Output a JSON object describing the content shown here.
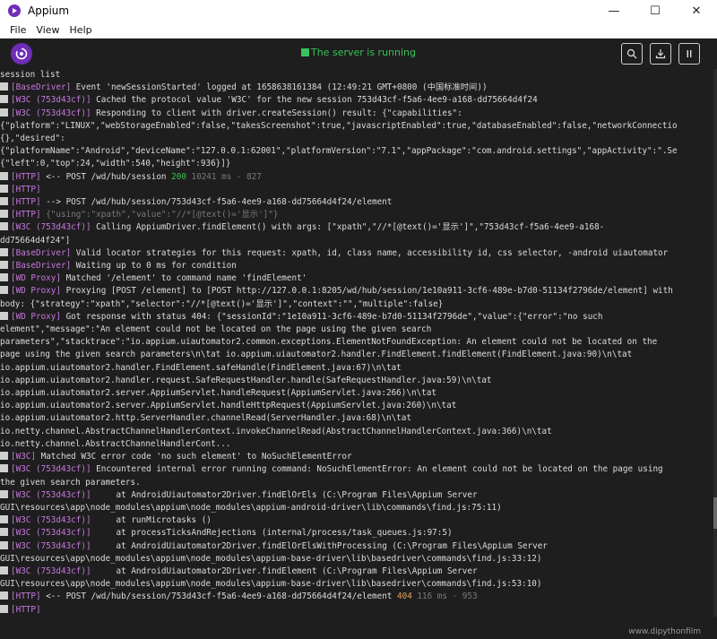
{
  "window": {
    "title": "Appium",
    "minimize": "—",
    "maximize": "☐",
    "close": "✕"
  },
  "menu": [
    "File",
    "View",
    "Help"
  ],
  "header": {
    "status": "The server is running"
  },
  "log_lines": [
    {
      "text": "session list"
    },
    {
      "tag": "[BaseDriver]",
      "text": " Event 'newSessionStarted' logged at 1658638161384 (12:49:21 GMT+0800 (中国标准时间))"
    },
    {
      "tag": "[W3C (753d43cf)]",
      "text": " Cached the protocol value 'W3C' for the new session 753d43cf-f5a6-4ee9-a168-dd75664d4f24"
    },
    {
      "tag": "[W3C (753d43cf)]",
      "text": " Responding to client with driver.createSession() result: {\"capabilities\":"
    },
    {
      "cont": "{\"platform\":\"LINUX\",\"webStorageEnabled\":false,\"takesScreenshot\":true,\"javascriptEnabled\":true,\"databaseEnabled\":false,\"networkConnectio"
    },
    {
      "cont": "{},\"desired\":"
    },
    {
      "cont": "{\"platformName\":\"Android\",\"deviceName\":\"127.0.0.1:62001\",\"platformVersion\":\"7.1\",\"appPackage\":\"com.android.settings\",\"appActivity\":\".Se"
    },
    {
      "cont": "{\"left\":0,\"top\":24,\"width\":540,\"height\":936}]}"
    },
    {
      "tag": "[HTTP]",
      "text": " <-- POST /wd/hub/session ",
      "code": "200",
      "code_class": "code-ok",
      "suffix": " 10241 ms - 827"
    },
    {
      "tag": "[HTTP]",
      "text": ""
    },
    {
      "tag": "[HTTP]",
      "text": " --> POST /wd/hub/session/753d43cf-f5a6-4ee9-a168-dd75664d4f24/element"
    },
    {
      "tag": "[HTTP]",
      "dimtext": " {\"using\":\"xpath\",\"value\":\"//*[@text()='显示']\"}"
    },
    {
      "tag": "[W3C (753d43cf)]",
      "text": " Calling AppiumDriver.findElement() with args: [\"xpath\",\"//*[@text()='显示']\",\"753d43cf-f5a6-4ee9-a168-"
    },
    {
      "cont": "dd75664d4f24\"]"
    },
    {
      "tag": "[BaseDriver]",
      "text": " Valid locator strategies for this request: xpath, id, class name, accessibility id, css selector, -android uiautomator"
    },
    {
      "tag": "[BaseDriver]",
      "text": " Waiting up to 0 ms for condition"
    },
    {
      "tag": "[WD Proxy]",
      "text": " Matched '/element' to command name 'findElement'"
    },
    {
      "tag": "[WD Proxy]",
      "text": " Proxying [POST /element] to [POST http://127.0.0.1:8205/wd/hub/session/1e10a911-3cf6-489e-b7d0-51134f2796de/element] with"
    },
    {
      "cont": "body: {\"strategy\":\"xpath\",\"selector\":\"//*[@text()='显示']\",\"context\":\"\",\"multiple\":false}"
    },
    {
      "tag": "[WD Proxy]",
      "text": " Got response with status 404: {\"sessionId\":\"1e10a911-3cf6-489e-b7d0-51134f2796de\",\"value\":{\"error\":\"no such"
    },
    {
      "cont": "element\",\"message\":\"An element could not be located on the page using the given search"
    },
    {
      "cont": "parameters\",\"stacktrace\":\"io.appium.uiautomator2.common.exceptions.ElementNotFoundException: An element could not be located on the"
    },
    {
      "cont": "page using the given search parameters\\n\\tat io.appium.uiautomator2.handler.FindElement.findElement(FindElement.java:90)\\n\\tat"
    },
    {
      "cont": "io.appium.uiautomator2.handler.FindElement.safeHandle(FindElement.java:67)\\n\\tat"
    },
    {
      "cont": "io.appium.uiautomator2.handler.request.SafeRequestHandler.handle(SafeRequestHandler.java:59)\\n\\tat"
    },
    {
      "cont": "io.appium.uiautomator2.server.AppiumServlet.handleRequest(AppiumServlet.java:266)\\n\\tat"
    },
    {
      "cont": "io.appium.uiautomator2.server.AppiumServlet.handleHttpRequest(AppiumServlet.java:260)\\n\\tat"
    },
    {
      "cont": "io.appium.uiautomator2.http.ServerHandler.channelRead(ServerHandler.java:68)\\n\\tat"
    },
    {
      "cont": "io.netty.channel.AbstractChannelHandlerContext.invokeChannelRead(AbstractChannelHandlerContext.java:366)\\n\\tat"
    },
    {
      "cont": "io.netty.channel.AbstractChannelHandlerCont..."
    },
    {
      "tag": "[W3C]",
      "text": " Matched W3C error code 'no such element' to NoSuchElementError"
    },
    {
      "tag": "[W3C (753d43cf)]",
      "text": " Encountered internal error running command: NoSuchElementError: An element could not be located on the page using"
    },
    {
      "cont": "the given search parameters."
    },
    {
      "tag": "[W3C (753d43cf)]",
      "text": "     at AndroidUiautomator2Driver.findElOrEls (C:\\Program Files\\Appium Server"
    },
    {
      "cont": "GUI\\resources\\app\\node_modules\\appium\\node_modules\\appium-android-driver\\lib\\commands\\find.js:75:11)"
    },
    {
      "tag": "[W3C (753d43cf)]",
      "text": "     at runMicrotasks ()"
    },
    {
      "tag": "[W3C (753d43cf)]",
      "text": "     at processTicksAndRejections (internal/process/task_queues.js:97:5)"
    },
    {
      "tag": "[W3C (753d43cf)]",
      "text": "     at AndroidUiautomator2Driver.findElOrElsWithProcessing (C:\\Program Files\\Appium Server"
    },
    {
      "cont": "GUI\\resources\\app\\node_modules\\appium\\node_modules\\appium-base-driver\\lib\\basedriver\\commands\\find.js:33:12)"
    },
    {
      "tag": "[W3C (753d43cf)]",
      "text": "     at AndroidUiautomator2Driver.findElement (C:\\Program Files\\Appium Server"
    },
    {
      "cont": "GUI\\resources\\app\\node_modules\\appium\\node_modules\\appium-base-driver\\lib\\basedriver\\commands\\find.js:53:10)"
    },
    {
      "tag": "[HTTP]",
      "text": " <-- POST /wd/hub/session/753d43cf-f5a6-4ee9-a168-dd75664d4f24/element ",
      "code": "404",
      "code_class": "code-err",
      "suffix": " 116 ms - 953"
    },
    {
      "tag": "[HTTP]",
      "text": ""
    }
  ],
  "watermark": "www.dipythonfilm",
  "colors": {
    "accent": "#6f2db8",
    "running": "#3ac25b",
    "tag": "#c678dd",
    "background": "#1e1e1e"
  },
  "icons": {
    "search": "search-icon",
    "download": "download-icon",
    "pause": "pause-icon",
    "terminal": "terminal-icon"
  }
}
